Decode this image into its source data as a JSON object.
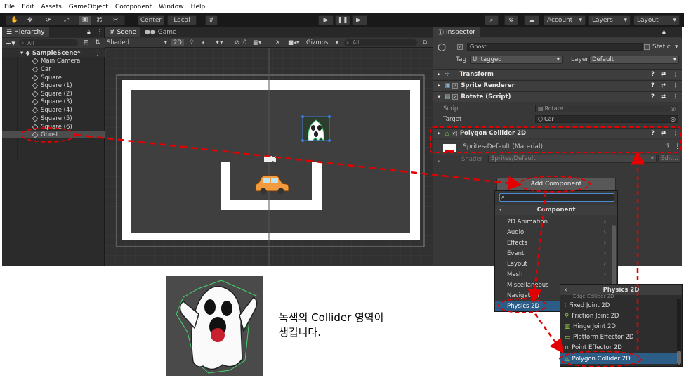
{
  "menubar": [
    "File",
    "Edit",
    "Assets",
    "GameObject",
    "Component",
    "Window",
    "Help"
  ],
  "toolbar": {
    "center": "Center",
    "local": "Local",
    "account": "Account",
    "layers": "Layers",
    "layout": "Layout"
  },
  "hierarchy": {
    "title": "Hierarchy",
    "search": "All",
    "scene": "SampleScene*",
    "items": [
      "Main Camera",
      "Car",
      "Square",
      "Square (1)",
      "Square (2)",
      "Square (3)",
      "Square (4)",
      "Square (5)",
      "Square (6)",
      "Ghost"
    ]
  },
  "scene": {
    "tab_scene": "Scene",
    "tab_game": "Game",
    "shaded": "Shaded",
    "mode2d": "2D",
    "hidden_count": "0",
    "gizmos": "Gizmos",
    "search": "All"
  },
  "inspector": {
    "title": "Inspector",
    "object_name": "Ghost",
    "static": "Static",
    "tag_label": "Tag",
    "tag": "Untagged",
    "layer_label": "Layer",
    "layer": "Default",
    "components": [
      "Transform",
      "Sprite Renderer",
      "Rotate (Script)"
    ],
    "script_label": "Script",
    "script_value": "Rotate",
    "target_label": "Target",
    "target_value": "Car",
    "collider": "Polygon Collider 2D",
    "material": "Sprites-Default (Material)",
    "shader_label": "Shader",
    "shader_value": "Sprites/Default",
    "edit": "Edit..."
  },
  "add_component": {
    "button": "Add Component",
    "header": "Component",
    "items": [
      "2D Animation",
      "Audio",
      "Effects",
      "Event",
      "Layout",
      "Mesh",
      "Miscellaneous",
      "Navigation",
      "Physics 2D"
    ]
  },
  "physics2d": {
    "header": "Physics 2D",
    "items": [
      "Edge Collider 2D",
      "Fixed Joint 2D",
      "Friction Joint 2D",
      "Hinge Joint 2D",
      "Platform Effector 2D",
      "Point Effector 2D",
      "Polygon Collider 2D"
    ]
  },
  "caption": {
    "line1": "녹색의 Collider 영역이",
    "line2": "생깁니다."
  }
}
